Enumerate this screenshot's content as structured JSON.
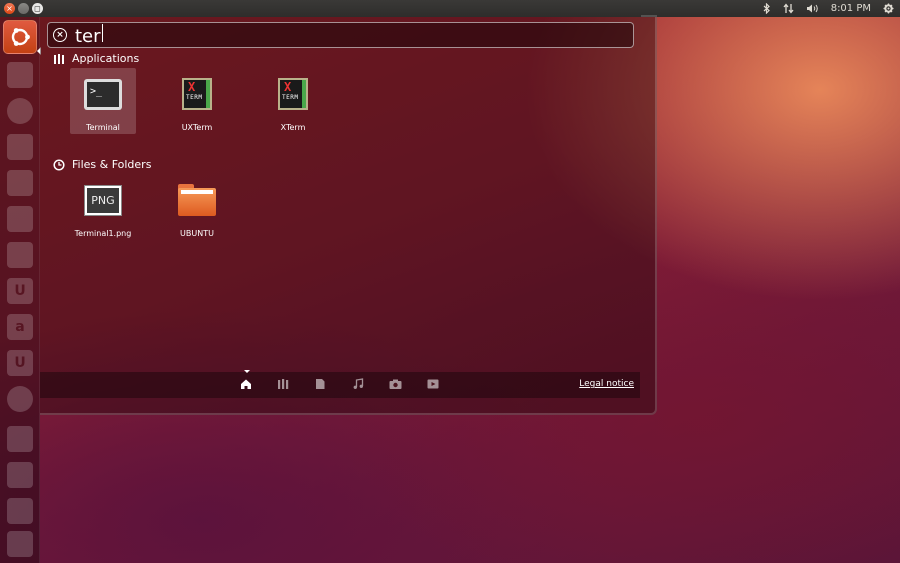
{
  "panel": {
    "time": "8:01 PM",
    "indicator_icons": [
      "bluetooth-icon",
      "network-icon",
      "volume-icon",
      "session-gear-icon"
    ]
  },
  "launcher": {
    "items": [
      {
        "name": "dash-home",
        "glyph": ""
      },
      {
        "name": "files",
        "glyph": ""
      },
      {
        "name": "firefox",
        "glyph": ""
      },
      {
        "name": "writer",
        "glyph": ""
      },
      {
        "name": "calc",
        "glyph": ""
      },
      {
        "name": "impress",
        "glyph": ""
      },
      {
        "name": "software-center",
        "glyph": ""
      },
      {
        "name": "ubuntu-one",
        "glyph": "U"
      },
      {
        "name": "amazon",
        "glyph": "a"
      },
      {
        "name": "ubuntu-one-music",
        "glyph": "U"
      },
      {
        "name": "settings",
        "glyph": ""
      },
      {
        "name": "terminal",
        "glyph": ""
      },
      {
        "name": "workspaces",
        "glyph": ""
      },
      {
        "name": "drive",
        "glyph": ""
      },
      {
        "name": "trash",
        "glyph": ""
      }
    ]
  },
  "search": {
    "query": "ter"
  },
  "categories": {
    "applications": "Applications",
    "files": "Files & Folders"
  },
  "applications": [
    {
      "label": "Terminal",
      "icon": "terminal-icon"
    },
    {
      "label": "UXTerm",
      "icon": "xterm-icon"
    },
    {
      "label": "XTerm",
      "icon": "xterm-icon"
    }
  ],
  "files": [
    {
      "label": "Terminal1.png",
      "icon": "png-file-icon",
      "badge": "PNG"
    },
    {
      "label": "UBUNTU",
      "icon": "folder-icon"
    }
  ],
  "term_prompt": ">_",
  "xterm_text": {
    "x": "X",
    "term": "TERM"
  },
  "lenses": [
    "home-lens-icon",
    "applications-lens-icon",
    "files-lens-icon",
    "music-lens-icon",
    "photos-lens-icon",
    "video-lens-icon"
  ],
  "legal_notice": "Legal notice"
}
